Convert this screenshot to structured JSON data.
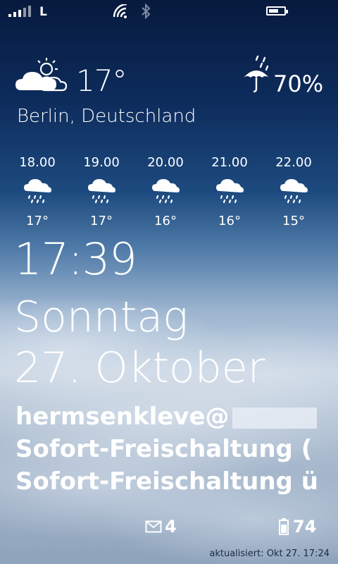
{
  "status_bar": {
    "network_type": "L",
    "signal_icon": "signal-bars-icon",
    "wifi_icon": "wifi-icon",
    "bluetooth_icon": "bluetooth-icon",
    "battery_icon": "battery-icon",
    "battery_fraction": 0.65
  },
  "weather": {
    "condition_icon": "partly-cloudy-icon",
    "temperature": "17°",
    "precip_icon": "umbrella-rain-icon",
    "precip_chance": "70%",
    "location": "Berlin, Deutschland",
    "forecast": [
      {
        "time": "18.00",
        "icon": "rain-cloud-icon",
        "temp": "17°"
      },
      {
        "time": "19.00",
        "icon": "rain-cloud-icon",
        "temp": "17°"
      },
      {
        "time": "20.00",
        "icon": "rain-cloud-icon",
        "temp": "16°"
      },
      {
        "time": "21.00",
        "icon": "rain-cloud-icon",
        "temp": "16°"
      },
      {
        "time": "22.00",
        "icon": "rain-cloud-icon",
        "temp": "15°"
      }
    ]
  },
  "clock": {
    "time": "17:39",
    "day": "Sonntag",
    "date": "27. Oktober"
  },
  "notifications": {
    "lines": [
      "hermsenkleve@",
      "Sofort-Freischaltung (",
      "Sofort-Freischaltung ü"
    ]
  },
  "badges": {
    "mail_icon": "mail-icon",
    "mail_count": "4",
    "battery_icon": "battery-vertical-icon",
    "battery_percent": "74"
  },
  "footer": {
    "updated": "aktualisiert: Okt 27. 17:24"
  }
}
